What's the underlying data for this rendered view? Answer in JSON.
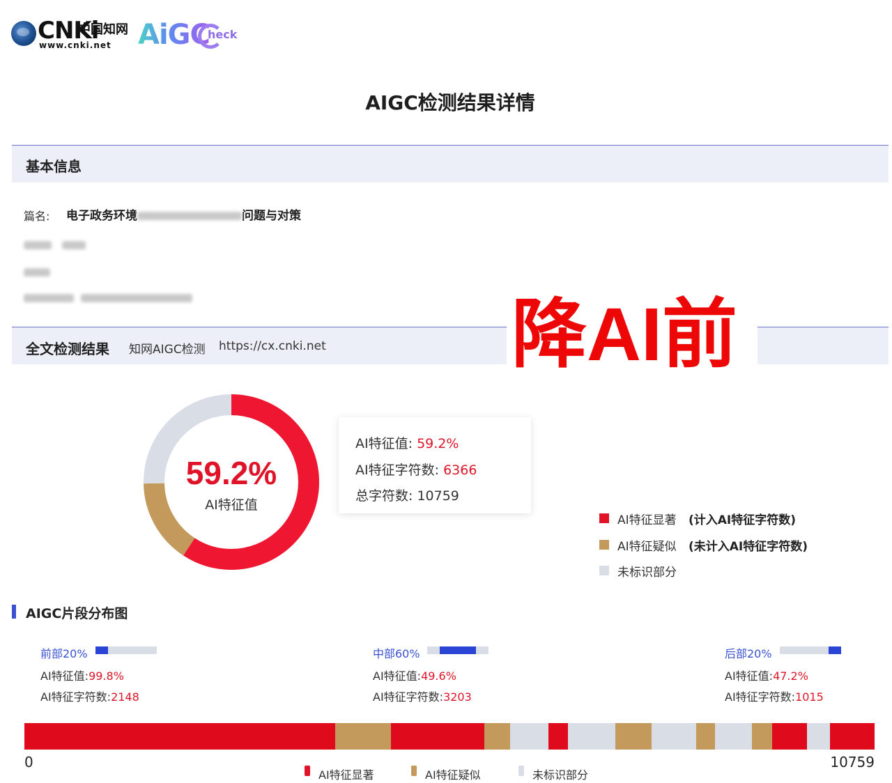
{
  "logo": {
    "cnki": "CNKi",
    "cn": "中国知网",
    "url": "www.cnki.net",
    "aigc": "AiGC",
    "check": "heck"
  },
  "title": "AIGC检测结果详情",
  "basic_info": {
    "heading": "基本信息",
    "title_label": "篇名:",
    "title_prefix": "电子政务环境",
    "title_suffix": "问题与对策"
  },
  "full_result": {
    "heading": "全文检测结果",
    "source": "知网AIGC检测",
    "url": "https://cx.cnki.net"
  },
  "stamp": "降AI前",
  "summary": {
    "percent": "59.2%",
    "percent_label": "AI特征值",
    "ai_value_label": "AI特征值:",
    "ai_value": "59.2%",
    "ai_chars_label": "AI特征字符数:",
    "ai_chars": "6366",
    "total_chars_label": "总字符数:",
    "total_chars": "10759"
  },
  "donut": {
    "significant": 59.2,
    "suspected": 15.5,
    "unmarked": 25.3
  },
  "legend": [
    {
      "label": "AI特征显著",
      "note": "(计入AI特征字符数)",
      "color": "#df1428"
    },
    {
      "label": "AI特征疑似",
      "note": "(未计入AI特征字符数)",
      "color": "#c49a5c"
    },
    {
      "label": "未标识部分",
      "note": "",
      "color": "#d9dde6"
    }
  ],
  "distribution": {
    "heading": "AIGC片段分布图",
    "segments": [
      {
        "name": "前部20%",
        "bar_from": 0.0,
        "bar_to": 0.2,
        "value_label": "AI特征值:",
        "value": "99.8%",
        "chars_label": "AI特征字符数:",
        "chars": "2148"
      },
      {
        "name": "中部60%",
        "bar_from": 0.2,
        "bar_to": 0.8,
        "value_label": "AI特征值:",
        "value": "49.6%",
        "chars_label": "AI特征字符数:",
        "chars": "3203"
      },
      {
        "name": "后部20%",
        "bar_from": 0.8,
        "bar_to": 1.0,
        "value_label": "AI特征值:",
        "value": "47.2%",
        "chars_label": "AI特征字符数:",
        "chars": "1015"
      }
    ],
    "axis_start": "0",
    "axis_end": "10759",
    "bar_total": 10759,
    "bar_blocks": [
      {
        "type": "significant",
        "from": 0,
        "to": 3931
      },
      {
        "type": "suspected",
        "from": 3931,
        "to": 4637
      },
      {
        "type": "significant",
        "from": 4637,
        "to": 5819
      },
      {
        "type": "suspected",
        "from": 5819,
        "to": 6150
      },
      {
        "type": "unmarked",
        "from": 6150,
        "to": 6635
      },
      {
        "type": "significant",
        "from": 6635,
        "to": 6882
      },
      {
        "type": "unmarked",
        "from": 6882,
        "to": 7477
      },
      {
        "type": "suspected",
        "from": 7477,
        "to": 7935
      },
      {
        "type": "unmarked",
        "from": 7935,
        "to": 8504
      },
      {
        "type": "suspected",
        "from": 8504,
        "to": 8742
      },
      {
        "type": "unmarked",
        "from": 8742,
        "to": 9205
      },
      {
        "type": "suspected",
        "from": 9205,
        "to": 9461
      },
      {
        "type": "significant",
        "from": 9461,
        "to": 9902
      },
      {
        "type": "unmarked",
        "from": 9902,
        "to": 10194
      },
      {
        "type": "significant",
        "from": 10194,
        "to": 10759
      }
    ]
  },
  "bottom_legend": [
    "AI特征显著",
    "AI特征疑似",
    "未标识部分"
  ]
}
